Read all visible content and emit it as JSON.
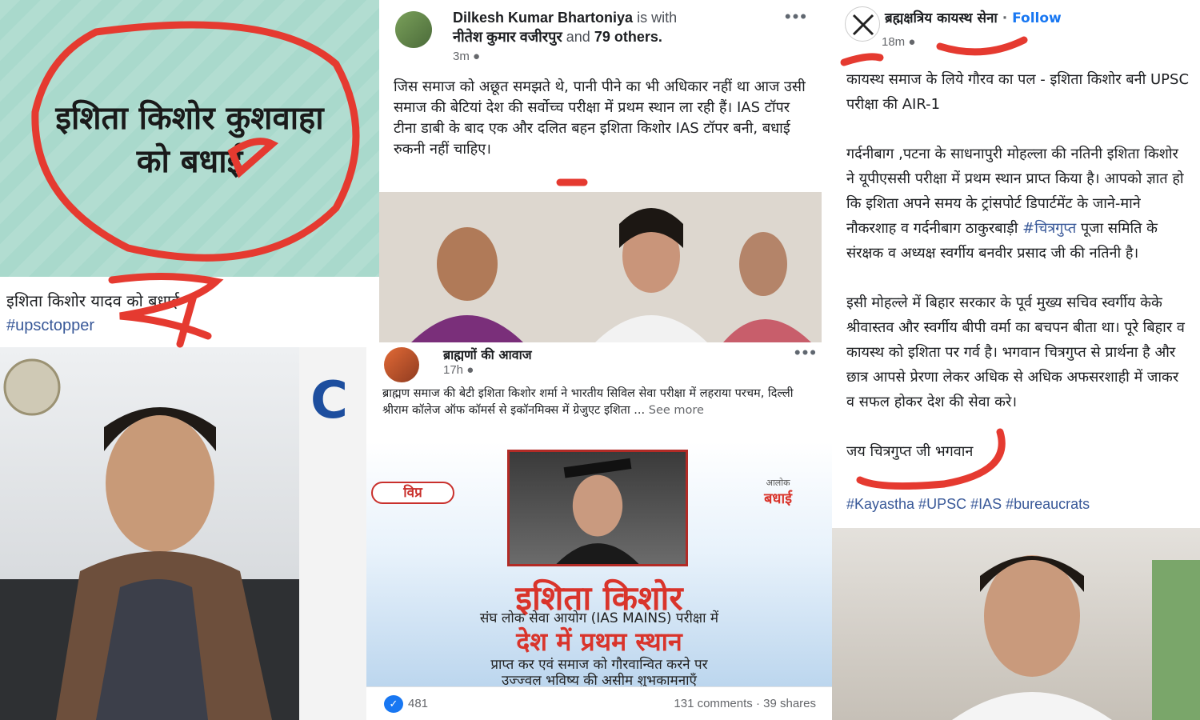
{
  "banner": {
    "line1": "इशिता किशोर कुशवाहा",
    "line2": "को बधाई"
  },
  "caption": {
    "text": "इशिता किशोर यादव को बधाई",
    "hashtag": "#upsctopper"
  },
  "logo_strip": {
    "letter": "C"
  },
  "post1": {
    "author": "Dilkesh Kumar Bhartoniya",
    "with_word": "is with",
    "tagged": "नीतेश कुमार वजीरपुर",
    "and_word": "and",
    "others": "79 others.",
    "time": "3m",
    "privacy_icon": "globe-icon",
    "more_icon": "more-horizontal-icon",
    "body": "जिस समाज को अछूत समझते थे, पानी पीने का भी अधिकार नहीं था आज उसी समाज की बेटियां देश की सर्वोच्च परीक्षा में प्रथम स्थान ला रही हैं। IAS टॉपर टीना डाबी के बाद एक और दलित बहन इशिता किशोर IAS टॉपर बनी, बधाई रुकनी नहीं चाहिए।"
  },
  "post2": {
    "author": "ब्राह्मणों की आवाज",
    "time": "17h",
    "privacy_icon": "globe-icon",
    "more_icon": "more-horizontal-icon",
    "body": "ब्राह्मण समाज की बेटी इशिता किशोर शर्मा ने भारतीय सिविल सेवा परीक्षा में लहराया परचम, दिल्ली श्रीराम कॉलेज ऑफ कॉमर्स से इकॉनमिक्स में ग्रेजुएट इशिता ...",
    "see_more": "See more"
  },
  "poster": {
    "badge": "विप्र",
    "wish_small": "आलोक",
    "wish": "बधाई",
    "name": "इशिता किशोर",
    "line1": "संघ लोक सेवा आयोग (IAS MAINS) परीक्षा में",
    "rank": "देश में प्रथम स्थान",
    "line2": "प्राप्त कर एवं समाज को गौरवान्वित करने पर",
    "line3": "उज्ज्वल भविष्य की असीम शुभकामनाएँ"
  },
  "reactions": {
    "like_icon": "like-thumb-icon",
    "count": "481",
    "comments": "131 comments",
    "separator": "·",
    "shares": "39 shares"
  },
  "post3": {
    "author": "ब्रह्मक्षत्रिय कायस्थ सेना",
    "separator": "·",
    "follow": "Follow",
    "time": "18m",
    "privacy_icon": "globe-icon",
    "para1": "कायस्थ समाज के लिये गौरव का पल - इशिता किशोर बनी UPSC परीक्षा की AIR-1",
    "para2_a": "गर्दनीबाग ,पटना के साधनापुरी मोहल्ला की नतिनी इशिता किशोर ने यूपीएससी परीक्षा में प्रथम स्थान प्राप्त किया है। आपको ज्ञात हो कि इशिता अपने समय के ट्रांसपोर्ट डिपार्टमेंट के जाने-माने नौकरशाह व गर्दनीबाग ठाकुरबाड़ी ",
    "para2_link": "#चित्रगुप्त",
    "para2_b": " पूजा समिति के संरक्षक व अध्यक्ष स्वर्गीय बनवीर प्रसाद जी की नतिनी है।",
    "para3": "इसी मोहल्ले में बिहार सरकार के पूर्व मुख्य सचिव स्वर्गीय केके श्रीवास्तव और स्वर्गीय बीपी वर्मा का बचपन बीता था। पूरे बिहार व कायस्थ को इशिता पर गर्व है। भगवान चित्रगुप्त से प्रार्थना है और छात्र आपसे प्रेरणा लेकर अधिक से अधिक अफसरशाही में जाकर व सफल होकर देश की सेवा करे।",
    "para4": "जय चित्रगुप्त जी भगवान",
    "tags": "#Kayastha #UPSC #IAS #bureaucrats"
  },
  "colors": {
    "marker_red": "#e53a30",
    "link_blue": "#385898",
    "banner_teal": "#a9d9cc",
    "poster_red": "#d9342b"
  }
}
